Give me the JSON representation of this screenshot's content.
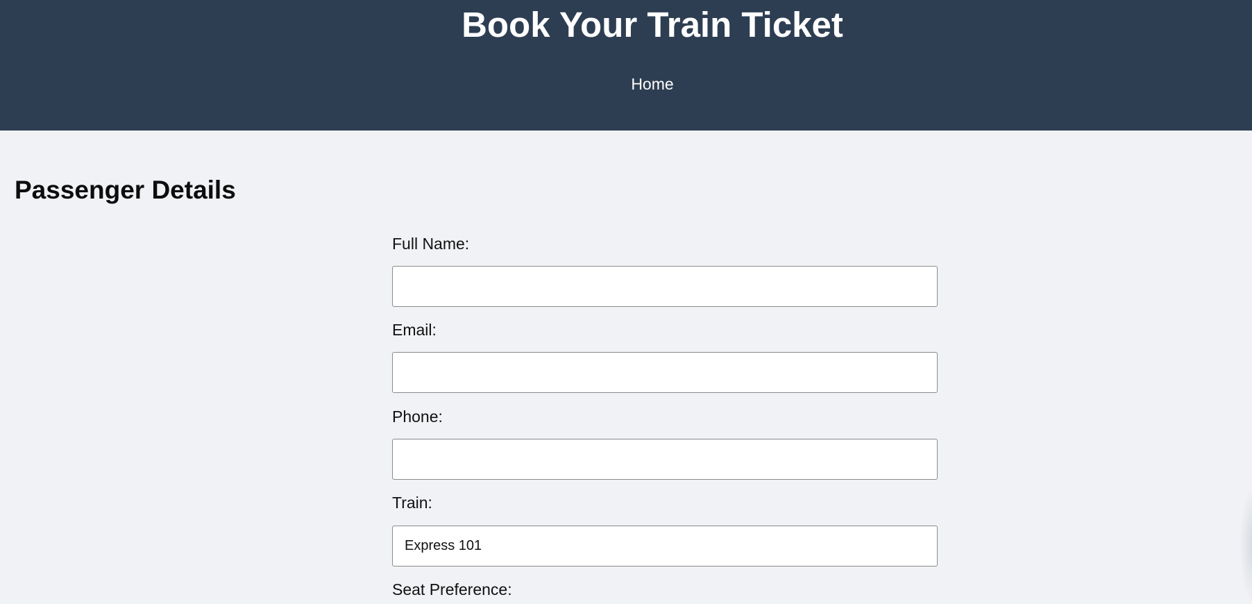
{
  "header": {
    "title": "Book Your Train Ticket",
    "nav_home": "Home"
  },
  "colors": {
    "header_bg": "#2e3e52",
    "page_bg": "#f0f2f5"
  },
  "form": {
    "section_title": "Passenger Details",
    "full_name_label": "Full Name:",
    "full_name_value": "",
    "email_label": "Email:",
    "email_value": "",
    "phone_label": "Phone:",
    "phone_value": "",
    "train_label": "Train:",
    "train_value": "Express 101",
    "seat_label": "Seat Preference:"
  }
}
